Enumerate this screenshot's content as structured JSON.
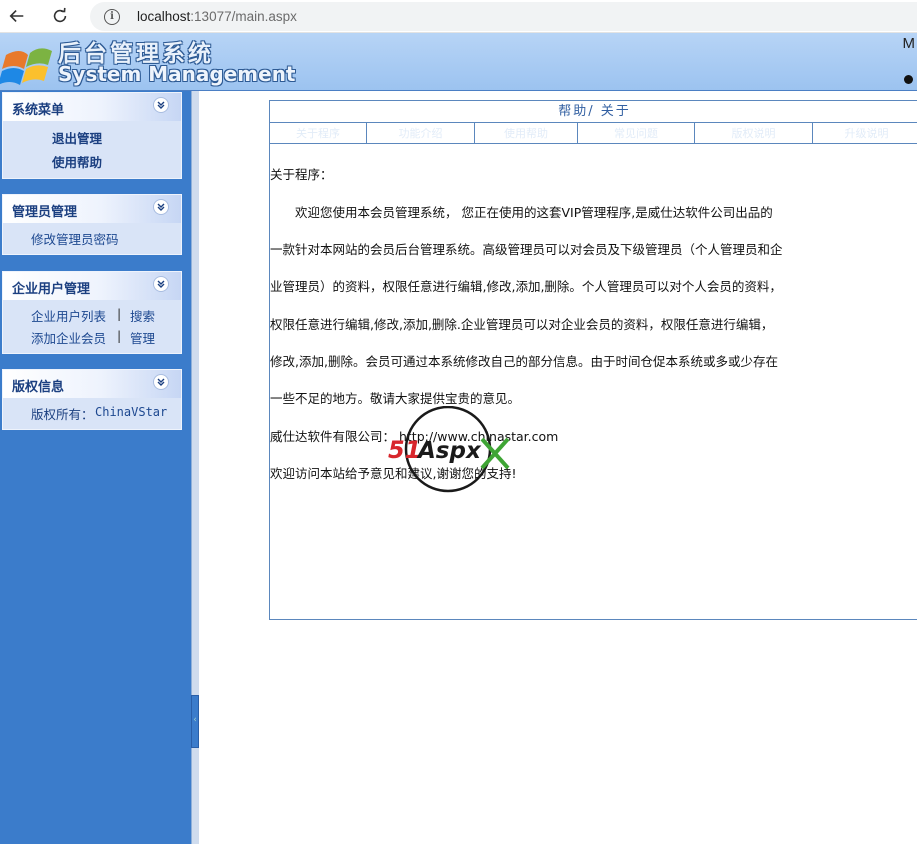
{
  "browser": {
    "url_host": "localhost",
    "url_rest": ":13077/main.aspx"
  },
  "header": {
    "title": "后台管理系统",
    "subtitle": "System Management",
    "right_text": "M"
  },
  "sidebar": {
    "panels": [
      {
        "title": "系统菜单",
        "items": [
          "退出管理",
          "使用帮助"
        ]
      },
      {
        "title": "管理员管理",
        "items": [
          "修改管理员密码"
        ]
      },
      {
        "title": "企业用户管理",
        "items": [
          "企业用户列表",
          "|",
          "搜索",
          "添加企业会员",
          "|",
          "管理"
        ]
      },
      {
        "title": "版权信息",
        "items": [
          "版权所有：",
          "ChinaVStar"
        ]
      }
    ]
  },
  "help": {
    "title": "帮助/ 关于",
    "tabs": [
      "关于程序",
      "功能介绍",
      "使用帮助",
      "常见问题",
      "版权说明",
      "升级说明"
    ],
    "heading": "关于程序：",
    "lines": [
      "　　欢迎您使用本会员管理系统，  您正在使用的这套VIP管理程序,是威仕达软件公司出品的",
      "一款针对本网站的会员后台管理系统。高级管理员可以对会员及下级管理员（个人管理员和企",
      "业管理员）的资料，权限任意进行编辑,修改,添加,删除。个人管理员可以对个人会员的资料，",
      "权限任意进行编辑,修改,添加,删除.企业管理员可以对企业会员的资料，权限任意进行编辑，",
      "修改,添加,删除。会员可通过本系统修改自己的部分信息。由于时间仓促本系统或多或少存在",
      "一些不足的地方。敬请大家提供宝贵的意见。",
      "威仕达软件有限公司：  http://www.chinastar.com",
      "欢迎访问本站给予意见和建议,谢谢您的支持!"
    ]
  },
  "watermark": {
    "brand": "51Aspx"
  },
  "colors": {
    "sidebar_bg": "#3b7ccb",
    "header_bg": "#b7d4f6",
    "panel_bg": "#d9e4f7",
    "link_color": "#1d4890",
    "border_blue": "#5b87bd"
  }
}
